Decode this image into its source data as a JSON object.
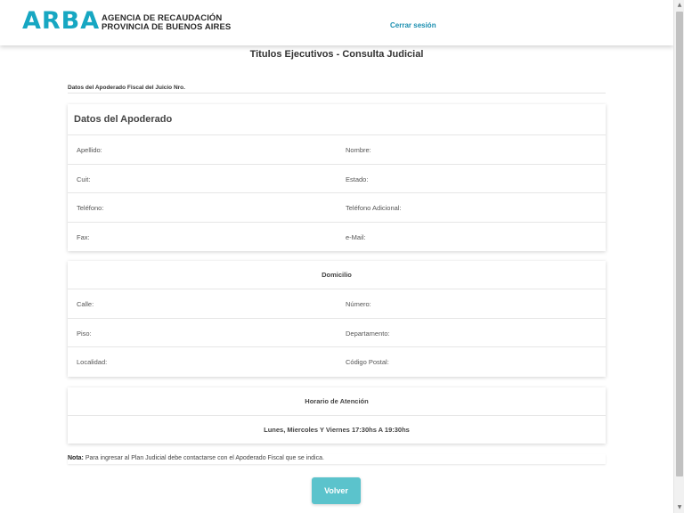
{
  "header": {
    "logo_text": "ARBA",
    "agency_line1": "AGENCIA DE RECAUDACIÓN",
    "agency_line2": "PROVINCIA DE BUENOS AIRES",
    "logout_label": "Cerrar sesión"
  },
  "page_title": "Titulos Ejecutivos - Consulta Judicial",
  "subheading": "Datos del Apoderado Fiscal del Juicio Nro.",
  "apoderado": {
    "title": "Datos del Apoderado",
    "rows": [
      {
        "left": "Apellido:",
        "right": "Nombre:"
      },
      {
        "left": "Cuit:",
        "right": "Estado:"
      },
      {
        "left": "Teléfono:",
        "right": "Teléfono Adicional:"
      },
      {
        "left": "Fax:",
        "right": "e-Mail:"
      }
    ]
  },
  "domicilio": {
    "title": "Domicilio",
    "rows": [
      {
        "left": "Calle:",
        "right": "Número:"
      },
      {
        "left": "Piso:",
        "right": "Departamento:"
      },
      {
        "left": "Localidad:",
        "right": "Código Postal:"
      }
    ]
  },
  "horario": {
    "title": "Horario de Atención",
    "schedule": "Lunes, Miercoles Y Viernes 17:30hs A 19:30hs"
  },
  "nota": {
    "label": "Nota:",
    "text": "Para ingresar al Plan Judicial debe contactarse con el Apoderado Fiscal que se indica."
  },
  "back_button_label": "Volver",
  "colors": {
    "brand": "#17a7c2",
    "button": "#5bc3cc",
    "link": "#1b8fb0"
  },
  "icons": {
    "scroll_up": "chevron-up-icon",
    "scroll_down": "chevron-down-icon"
  }
}
